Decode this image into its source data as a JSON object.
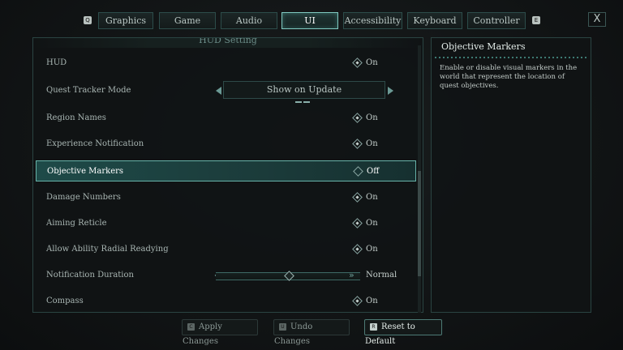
{
  "nav": {
    "prev_key": "Q",
    "next_key": "E",
    "tabs": [
      {
        "label": "Graphics"
      },
      {
        "label": "Game"
      },
      {
        "label": "Audio"
      },
      {
        "label": "UI"
      },
      {
        "label": "Accessibility"
      },
      {
        "label": "Keyboard"
      },
      {
        "label": "Controller"
      }
    ],
    "active_tab": "UI",
    "close_label": "X"
  },
  "panel": {
    "header": "HUD Setting",
    "rows": [
      {
        "label": "HUD",
        "value": "On"
      },
      {
        "label": "Quest Tracker Mode",
        "value": "Show on Update"
      },
      {
        "label": "Region Names",
        "value": "On"
      },
      {
        "label": "Experience Notification",
        "value": "On"
      },
      {
        "label": "Objective Markers",
        "value": "Off"
      },
      {
        "label": "Damage Numbers",
        "value": "On"
      },
      {
        "label": "Aiming Reticle",
        "value": "On"
      },
      {
        "label": "Allow Ability Radial Readying",
        "value": "On"
      },
      {
        "label": "Notification Duration",
        "value": "Normal"
      },
      {
        "label": "Compass",
        "value": "On"
      }
    ],
    "selected_row": "Objective Markers",
    "notification_duration_level": 0.5
  },
  "description": {
    "title": "Objective Markers",
    "text": "Enable or disable visual markers in the world that represent the location of quest objectives."
  },
  "footer": {
    "apply": {
      "key": "C",
      "label": "Apply Changes"
    },
    "undo": {
      "key": "U",
      "label": "Undo Changes"
    },
    "reset": {
      "key": "R",
      "label": "Reset to Default"
    }
  }
}
